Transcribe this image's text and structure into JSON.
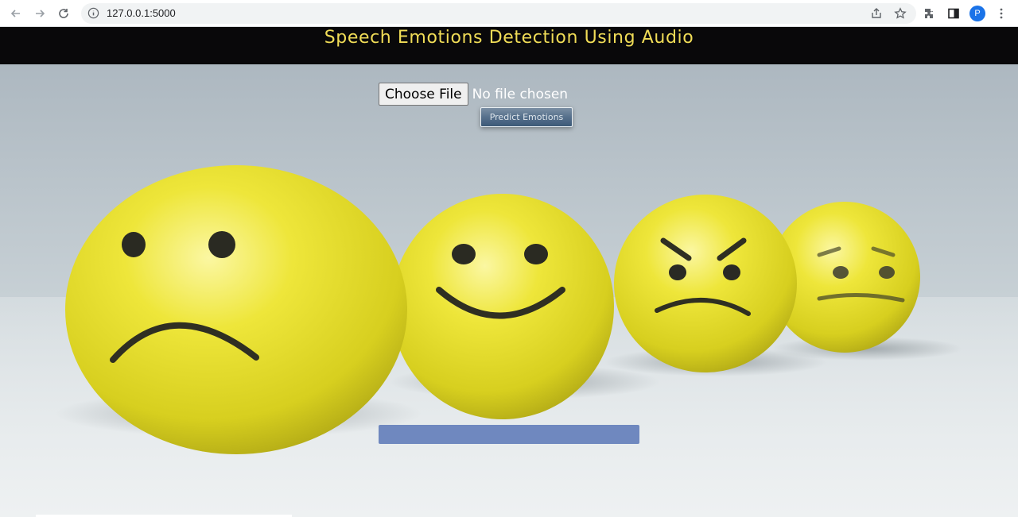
{
  "browser": {
    "url": "127.0.0.1:5000",
    "profile_initial": "P",
    "icons": [
      "back-arrow-icon",
      "forward-arrow-icon",
      "reload-icon",
      "info-icon",
      "share-icon",
      "star-icon",
      "extensions-icon",
      "side-panel-icon",
      "menu-icon"
    ]
  },
  "header": {
    "title": "Speech Emotions Detection Using Audio"
  },
  "form": {
    "choose_file_label": "Choose File",
    "file_status": "No file chosen",
    "predict_label": "Predict Emotions"
  },
  "result": {
    "text": ""
  },
  "colors": {
    "header_bg": "#09080a",
    "title_color": "#f0dc57",
    "result_bar": "#6f88bf",
    "emoji_yellow": "#e3dc2c"
  }
}
